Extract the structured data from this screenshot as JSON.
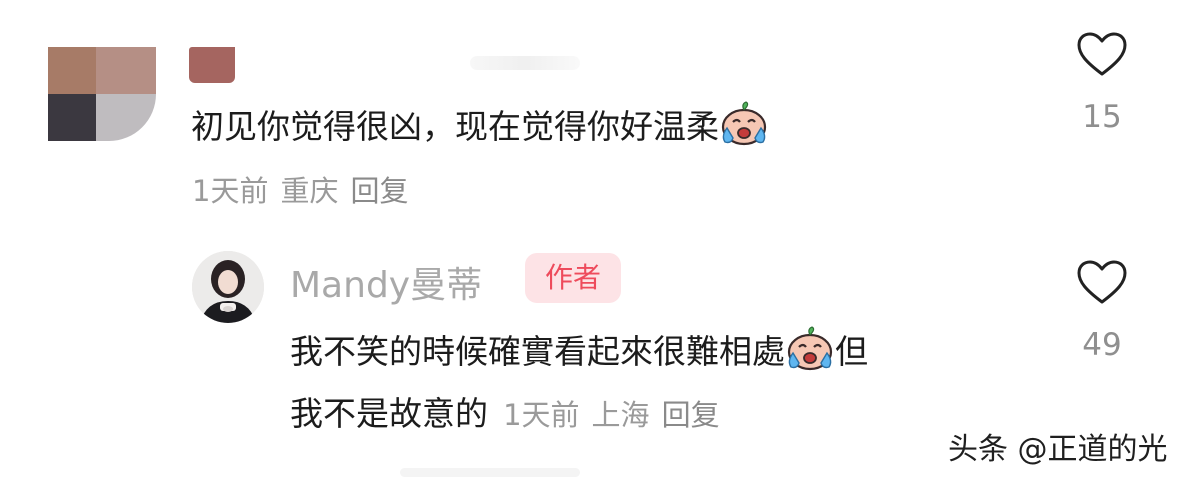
{
  "comment1": {
    "text": "初见你觉得很凶，现在觉得你好温柔",
    "emoji": "crying-face-emoji",
    "time": "1天前",
    "location": "重庆",
    "reply_label": "回复",
    "likes": "15"
  },
  "reply1": {
    "author": "Mandy曼蒂",
    "badge": "作者",
    "text_line1": "我不笑的時候確實看起來很難相處",
    "emoji": "crying-face-emoji",
    "text_line1_end": "但",
    "text_line2": "我不是故意的",
    "time": "1天前",
    "location": "上海",
    "reply_label": "回复",
    "likes": "49"
  },
  "watermark": "头条 @正道的光",
  "colors": {
    "badge_bg": "#fde3e6",
    "badge_text": "#ee4b5c",
    "meta_text": "#9a9a9a",
    "main_text": "#1c1c1c"
  }
}
